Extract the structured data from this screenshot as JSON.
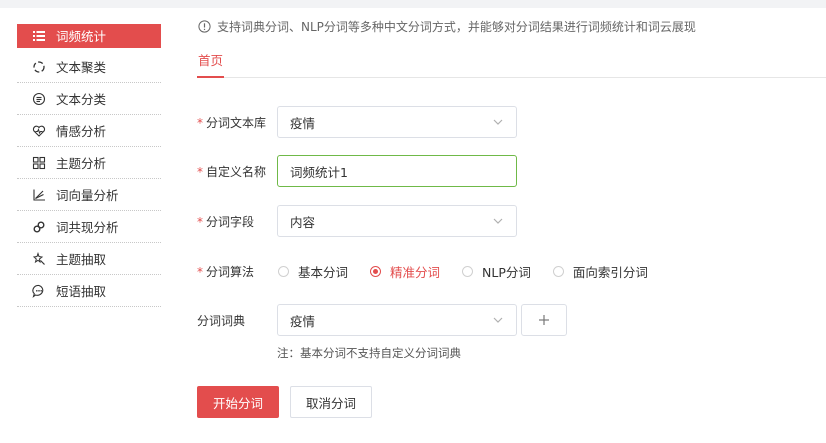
{
  "sidebar": {
    "items": [
      {
        "label": "词频统计",
        "icon": "list-icon",
        "active": true
      },
      {
        "label": "文本聚类",
        "icon": "cluster-icon"
      },
      {
        "label": "文本分类",
        "icon": "category-icon"
      },
      {
        "label": "情感分析",
        "icon": "heart-pulse-icon"
      },
      {
        "label": "主题分析",
        "icon": "grid-icon"
      },
      {
        "label": "词向量分析",
        "icon": "vector-chart-icon"
      },
      {
        "label": "词共现分析",
        "icon": "link-icon"
      },
      {
        "label": "主题抽取",
        "icon": "magic-wand-icon"
      },
      {
        "label": "短语抽取",
        "icon": "chat-bubble-icon"
      }
    ]
  },
  "notice": "支持词典分词、NLP分词等多种中文分词方式，并能够对分词结果进行词频统计和词云展现",
  "tabs": [
    {
      "label": "首页"
    }
  ],
  "form": {
    "corpus": {
      "label": "分词文本库",
      "value": "疫情"
    },
    "name": {
      "label": "自定义名称",
      "value": "词频统计1"
    },
    "field": {
      "label": "分词字段",
      "value": "内容"
    },
    "algorithm": {
      "label": "分词算法",
      "options": [
        {
          "label": "基本分词",
          "checked": false
        },
        {
          "label": "精准分词",
          "checked": true
        },
        {
          "label": "NLP分词",
          "checked": false
        },
        {
          "label": "面向索引分词",
          "checked": false
        }
      ]
    },
    "dictionary": {
      "label": "分词词典",
      "value": "疫情"
    },
    "note": "注：基本分词不支持自定义分词词典"
  },
  "actions": {
    "start": "开始分词",
    "cancel": "取消分词"
  },
  "colors": {
    "accent": "#e34d4d",
    "focus_border": "#6fb947",
    "border": "#dcdfe6"
  }
}
